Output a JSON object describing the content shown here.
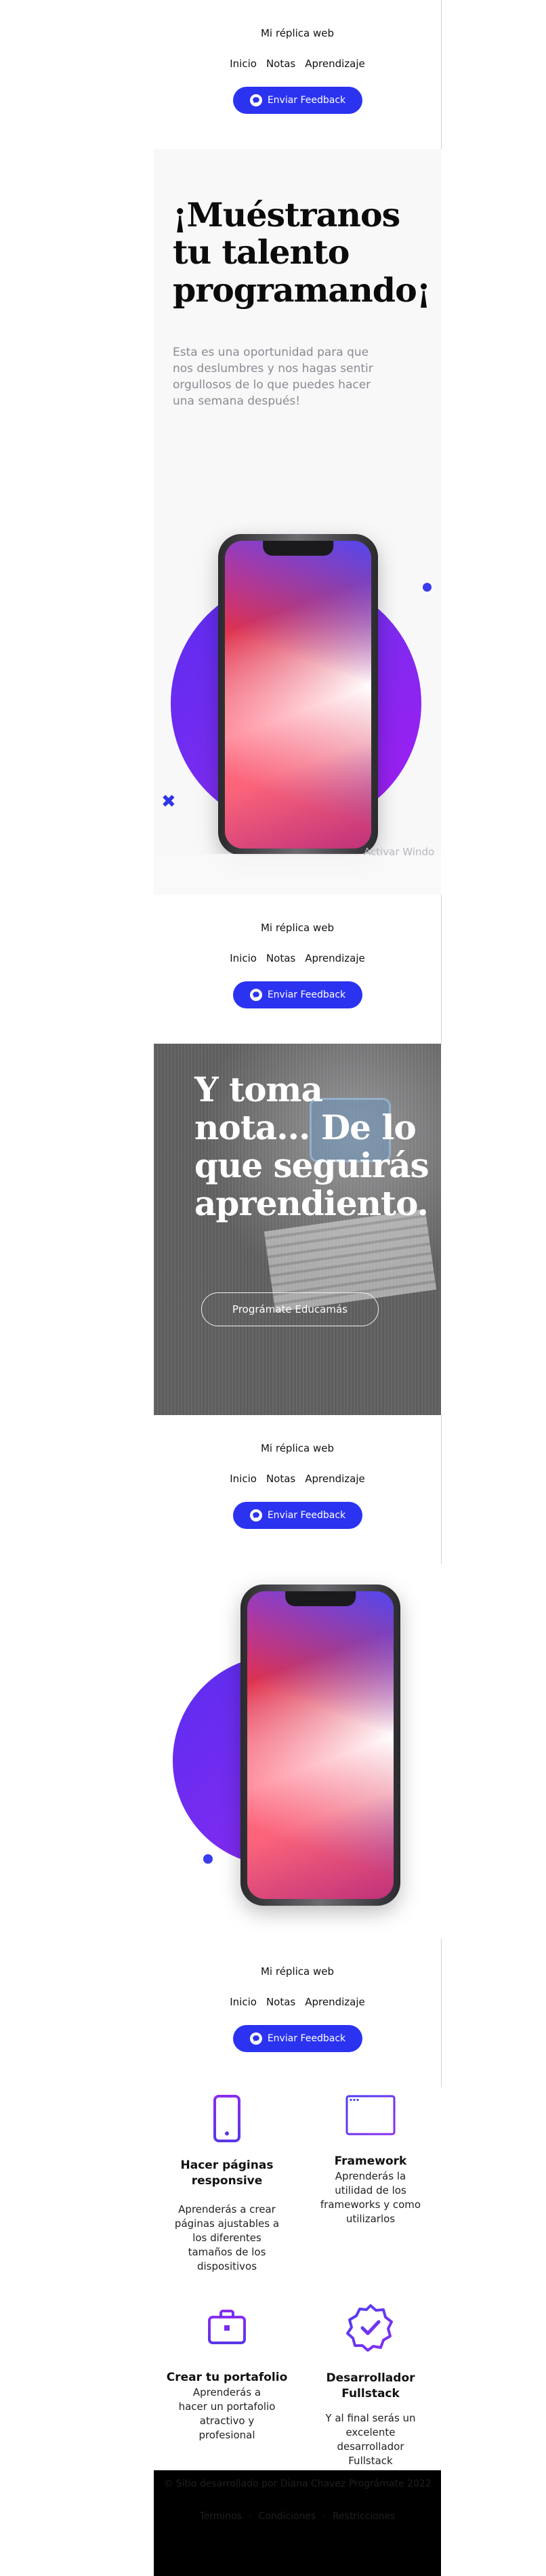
{
  "site": {
    "brand": "Mi réplica web",
    "nav": [
      "Inicio",
      "Notas",
      "Aprendizaje"
    ],
    "feedback_button": "Enviar Feedback"
  },
  "hero1": {
    "title": "¡Muéstranos tu talento programando¡",
    "subtitle": "Esta es una oportunidad para que nos deslumbres y nos hagas sentir orgullosos de lo que puedes hacer una semana después!",
    "watermark": "Activar Windo"
  },
  "hero2": {
    "title": "Y toma nota... De lo que seguirás aprendiento.",
    "button": "Prográmate Educamás"
  },
  "features": [
    {
      "icon": "smartphone-icon",
      "title": "Hacer páginas responsive",
      "desc": "Aprenderás a crear páginas ajustables a los diferentes tamaños de los dispositivos"
    },
    {
      "icon": "browser-window-icon",
      "title": "Framework",
      "desc": "Aprenderás la utilidad de los frameworks y como utilizarlos"
    },
    {
      "icon": "briefcase-icon",
      "title": "Crear tu portafolio",
      "desc": "Aprenderás a hacer un portafolio atractivo y profesional"
    },
    {
      "icon": "verified-badge-icon",
      "title": "Desarrollador Fullstack",
      "desc": "Y al final serás un excelente desarrollador Fullstack"
    }
  ],
  "footer": {
    "copyright": "© Sitio desarrollado por Diana Chavez Prográmate 2022",
    "links": [
      "Terminos",
      "Condiciones",
      "Restricciones"
    ]
  },
  "colors": {
    "accent": "#2b33f0",
    "purple": "#7a2df0",
    "footer_bg": "#000000"
  }
}
